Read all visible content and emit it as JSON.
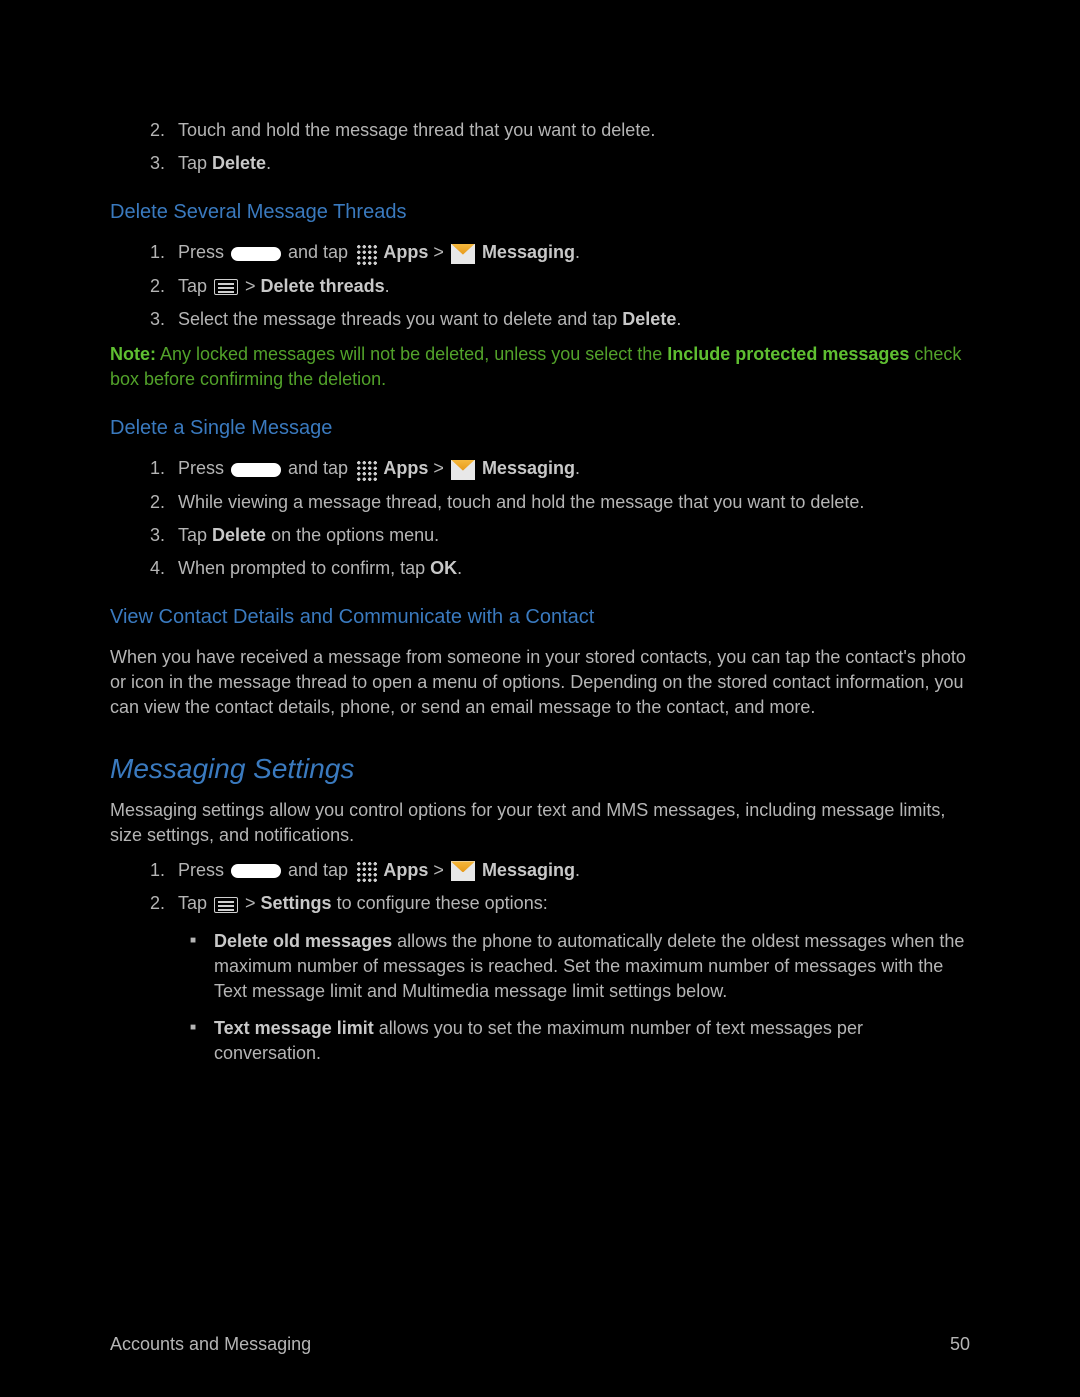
{
  "topList": {
    "item2_num": "2.",
    "item2_text": "Touch and hold the message thread that you want to delete.",
    "item3_num": "3.",
    "item3_pre": "Tap ",
    "item3_bold": "Delete",
    "item3_post": "."
  },
  "sec1": {
    "heading": "Delete Several Message Threads",
    "li1_num": "1.",
    "li1_a": "Press ",
    "li1_b": " and tap ",
    "li1_apps": " Apps",
    "li1_gt": " > ",
    "li1_msg": " Messaging",
    "li1_end": ".",
    "li2_num": "2.",
    "li2_a": "Tap ",
    "li2_gt": " > ",
    "li2_bold": "Delete threads",
    "li2_end": ".",
    "li3_num": "3.",
    "li3_a": "Select the message threads you want to delete and tap ",
    "li3_bold": "Delete",
    "li3_end": "."
  },
  "note": {
    "label": "Note:",
    "a": " Any locked messages will not be deleted, unless you select the ",
    "bold": "Include protected messages",
    "b": " check box before confirming the deletion."
  },
  "sec2": {
    "heading": "Delete a Single Message",
    "li1_num": "1.",
    "li1_a": "Press ",
    "li1_b": " and tap ",
    "li1_apps": " Apps",
    "li1_gt": " > ",
    "li1_msg": " Messaging",
    "li1_end": ".",
    "li2_num": "2.",
    "li2_text": "While viewing a message thread, touch and hold the message that you want to delete.",
    "li3_num": "3.",
    "li3_a": "Tap ",
    "li3_bold": "Delete",
    "li3_b": " on the options menu.",
    "li4_num": "4.",
    "li4_a": "When prompted to confirm, tap ",
    "li4_bold": "OK",
    "li4_end": "."
  },
  "sec3": {
    "heading": "View Contact Details and Communicate with a Contact",
    "para": "When you have received a message from someone in your stored contacts, you can tap the contact's photo or icon in the message thread to open a menu of options. Depending on the stored contact information, you can view the contact details, phone, or send an email message to the contact, and more."
  },
  "sec4": {
    "heading": "Messaging Settings",
    "intro": "Messaging settings allow you control options for your text and MMS messages, including message limits, size settings, and notifications.",
    "li1_num": "1.",
    "li1_a": "Press ",
    "li1_b": " and tap ",
    "li1_apps": " Apps",
    "li1_gt": " > ",
    "li1_msg": " Messaging",
    "li1_end": ".",
    "li2_num": "2.",
    "li2_a": "Tap ",
    "li2_gt": " > ",
    "li2_bold": "Settings",
    "li2_b": " to configure these options:",
    "b1_bold": "Delete old messages",
    "b1_text": " allows the phone to automatically delete the oldest messages when the maximum number of messages is reached. Set the maximum number of messages with the Text message limit and Multimedia message limit settings below.",
    "b2_bold": "Text message limit",
    "b2_text": " allows you to set the maximum number of text messages per conversation."
  },
  "footer": {
    "left": "Accounts and Messaging",
    "right": "50"
  }
}
